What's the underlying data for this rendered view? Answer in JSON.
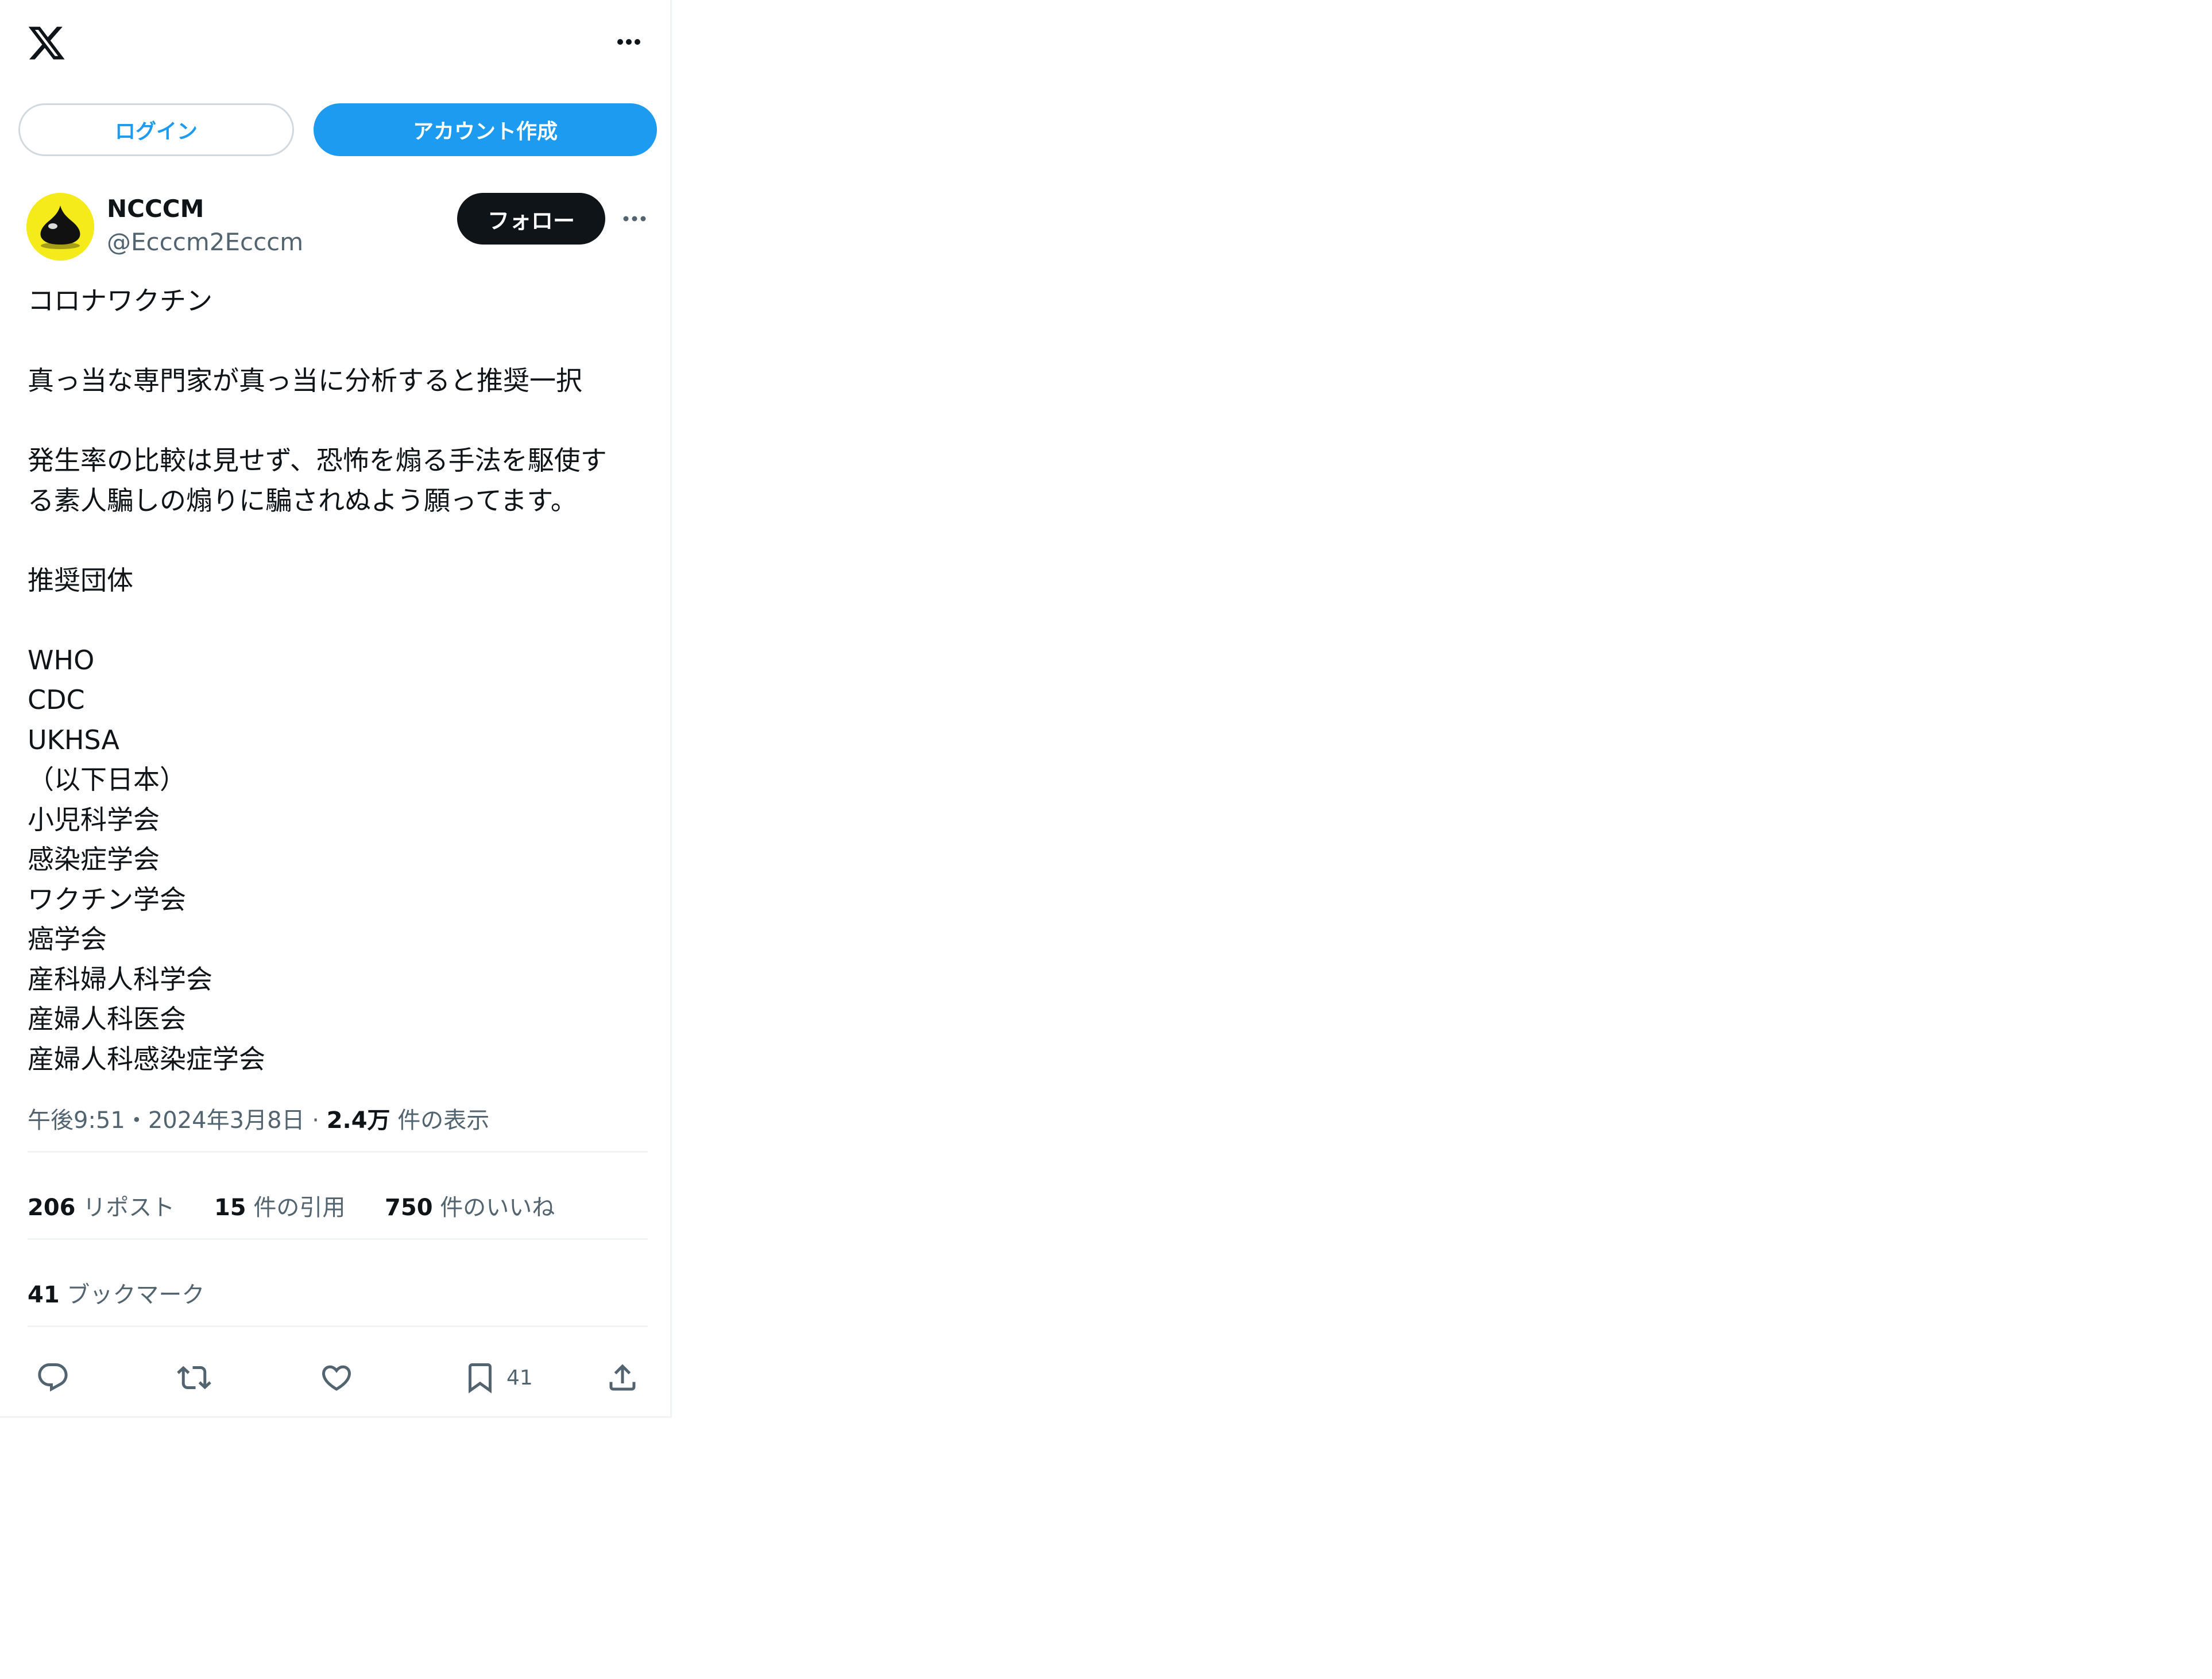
{
  "header": {
    "logo_icon": "x-logo-icon",
    "more_icon": "more-horizontal-icon"
  },
  "auth": {
    "login_label": "ログイン",
    "create_account_label": "アカウント作成"
  },
  "tweet": {
    "author": {
      "display_name": "NCCCM",
      "handle": "@Ecccm2Ecccm",
      "avatar_icon": "slime-avatar-icon"
    },
    "follow_label": "フォロー",
    "lines": [
      "コロナワクチン",
      "",
      "真っ当な専門家が真っ当に分析すると推奨一択",
      "",
      "発生率の比較は見せず、恐怖を煽る手法を駆使す",
      "る素人騙しの煽りに騙されぬよう願ってます。",
      "",
      "推奨団体",
      "",
      "WHO",
      "CDC",
      "UKHSA",
      "（以下日本）",
      "小児科学会",
      "感染症学会",
      "ワクチン学会",
      "癌学会",
      "産科婦人科学会",
      "産婦人科医会",
      "産婦人科感染症学会"
    ],
    "meta": {
      "time": "午後9:51",
      "separator": "・",
      "date": "2024年3月8日",
      "separator2": " · ",
      "views_count": "2.4万",
      "views_label": " 件の表示"
    },
    "stats": {
      "reposts_count": "206",
      "reposts_label": " リポスト",
      "quotes_count": "15",
      "quotes_label": " 件の引用",
      "likes_count": "750",
      "likes_label": " 件のいいね",
      "bookmarks_count": "41",
      "bookmarks_label": " ブックマーク"
    },
    "actions": {
      "reply_icon": "reply-icon",
      "repost_icon": "repost-icon",
      "like_icon": "heart-icon",
      "bookmark_icon": "bookmark-icon",
      "bookmark_count": "41",
      "share_icon": "share-icon"
    }
  },
  "colors": {
    "accent": "#1d9bf0",
    "text": "#0f1419",
    "secondary": "#536471",
    "border": "#eff3f4",
    "avatar_bg": "#f5ea1a"
  }
}
